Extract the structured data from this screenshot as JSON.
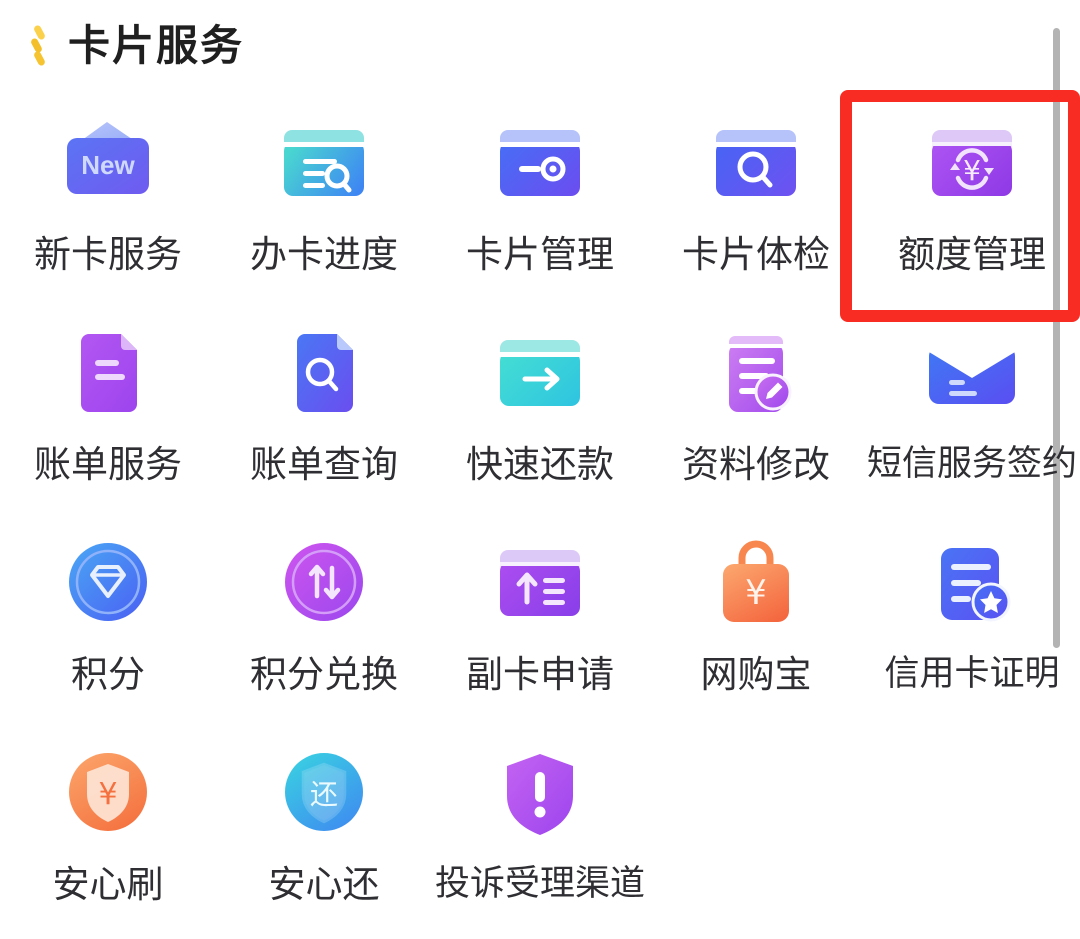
{
  "header": {
    "title": "卡片服务",
    "mark_icon": "three-gold-dashes-icon"
  },
  "scrollbar": {
    "name": "vertical-scrollbar",
    "color": "#b3b3b3"
  },
  "highlight": {
    "name": "red-annotation-box",
    "color": "#f92c23",
    "target_label": "额度管理"
  },
  "grid": {
    "columns": 5,
    "items": [
      {
        "id": "new-card-service",
        "label": "新卡服务",
        "icon": "card-new-icon",
        "colors": [
          "#5b74f4",
          "#6f5bf0"
        ]
      },
      {
        "id": "card-progress",
        "label": "办卡进度",
        "icon": "card-list-search-icon",
        "colors": [
          "#49d6d0",
          "#3e86f3"
        ]
      },
      {
        "id": "card-management",
        "label": "卡片管理",
        "icon": "card-slider-icon",
        "colors": [
          "#4a6bf5",
          "#6a4ef0"
        ]
      },
      {
        "id": "card-checkup",
        "label": "卡片体检",
        "icon": "card-search-icon",
        "colors": [
          "#4a63f4",
          "#6d52f1"
        ]
      },
      {
        "id": "limit-management",
        "label": "额度管理",
        "icon": "card-yen-refresh-icon",
        "colors": [
          "#a84df0",
          "#8f3ae6"
        ]
      },
      {
        "id": "bill-service",
        "label": "账单服务",
        "icon": "document-lines-icon",
        "colors": [
          "#b357f2",
          "#9d44ee"
        ]
      },
      {
        "id": "bill-query",
        "label": "账单查询",
        "icon": "document-search-icon",
        "colors": [
          "#4a77f4",
          "#6a4ef0"
        ]
      },
      {
        "id": "quick-repayment",
        "label": "快速还款",
        "icon": "card-arrow-right-icon",
        "colors": [
          "#43dcd4",
          "#2fc5e0"
        ]
      },
      {
        "id": "profile-edit",
        "label": "资料修改",
        "icon": "document-pencil-icon",
        "colors": [
          "#cc7df2",
          "#a44ced"
        ]
      },
      {
        "id": "sms-service-signup",
        "label": "短信服务签约",
        "icon": "envelope-icon",
        "colors": [
          "#3f79f4",
          "#5a4ef2"
        ]
      },
      {
        "id": "points",
        "label": "积分",
        "icon": "circle-gem-icon",
        "colors": [
          "#4aa8f5",
          "#4a5ef3"
        ]
      },
      {
        "id": "points-exchange",
        "label": "积分兑换",
        "icon": "circle-swap-arrows-icon",
        "colors": [
          "#cf55ef",
          "#9a47ee"
        ]
      },
      {
        "id": "supplementary-card",
        "label": "副卡申请",
        "icon": "card-upload-lines-icon",
        "colors": [
          "#a94cf0",
          "#8a3fe9"
        ]
      },
      {
        "id": "online-shopping",
        "label": "网购宝",
        "icon": "shopping-bag-yen-icon",
        "colors": [
          "#fba36b",
          "#f4673f"
        ]
      },
      {
        "id": "credit-certificate",
        "label": "信用卡证明",
        "icon": "document-star-icon",
        "colors": [
          "#4a74f5",
          "#5a52f2"
        ]
      },
      {
        "id": "safe-swipe",
        "label": "安心刷",
        "icon": "circle-shield-yen-icon",
        "colors": [
          "#fba268",
          "#f4713f"
        ]
      },
      {
        "id": "safe-repay",
        "label": "安心还",
        "icon": "circle-shield-repay-icon",
        "colors": [
          "#39d0e2",
          "#3f8bf0"
        ]
      },
      {
        "id": "complaint-channel",
        "label": "投诉受理渠道",
        "icon": "shield-exclamation-icon",
        "colors": [
          "#c463f2",
          "#9d45ee"
        ]
      }
    ]
  }
}
